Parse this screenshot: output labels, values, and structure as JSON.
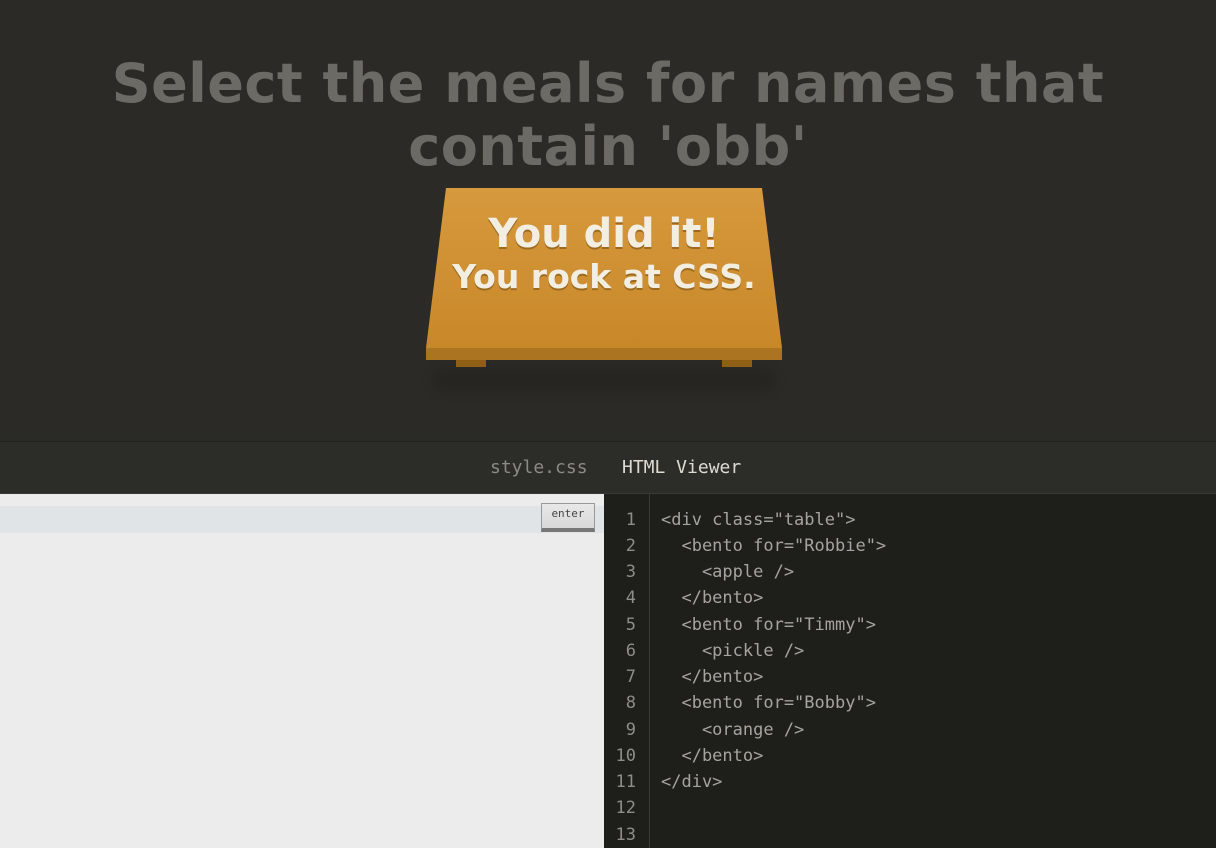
{
  "level": {
    "instruction": "Select the meals for names that contain 'obb'"
  },
  "success": {
    "line1": "You did it!",
    "line2": "You rock at CSS."
  },
  "tabs": [
    {
      "label": "style.css",
      "active": false
    },
    {
      "label": "HTML Viewer",
      "active": true
    }
  ],
  "css_editor": {
    "input_value": "",
    "placeholder": "",
    "enter_label": "enter"
  },
  "html_viewer": {
    "line_numbers": [
      "1",
      "2",
      "3",
      "4",
      "5",
      "6",
      "7",
      "8",
      "9",
      "10",
      "11",
      "12",
      "13"
    ],
    "lines": [
      "<div class=\"table\">",
      "  <bento for=\"Robbie\">",
      "    <apple />",
      "  </bento>",
      "  <bento for=\"Timmy\">",
      "    <pickle />",
      "  </bento>",
      "  <bento for=\"Bobby\">",
      "    <orange />",
      "  </bento>",
      "</div>",
      "",
      ""
    ]
  },
  "colors": {
    "background": "#2b2a26",
    "table": "#d7993d",
    "code_background": "#1e1e1b",
    "editor_background": "#ececec"
  }
}
